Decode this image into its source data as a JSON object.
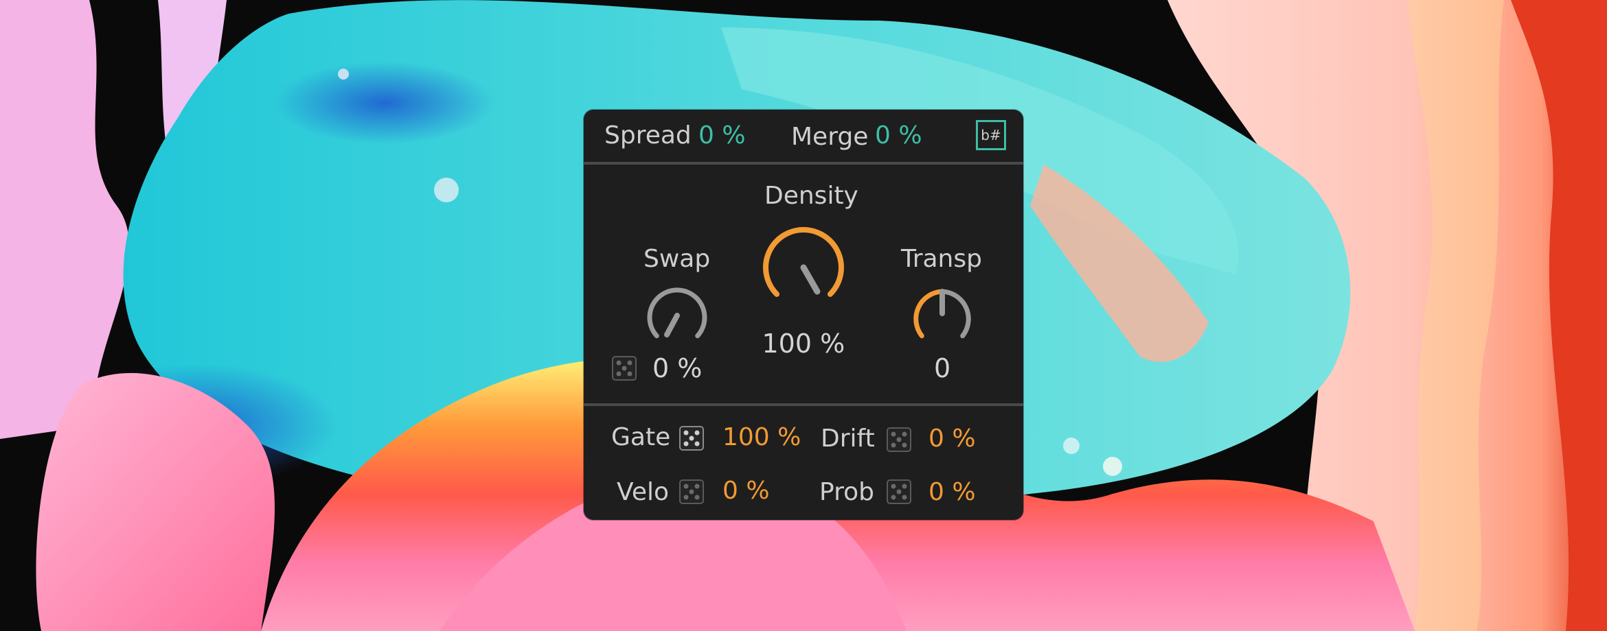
{
  "top": {
    "spread": {
      "label": "Spread",
      "value": "0 %"
    },
    "merge": {
      "label": "Merge",
      "value": "0 %"
    },
    "mode_button": {
      "glyph": "b#",
      "icon": "flat-sharp-icon"
    }
  },
  "knobs": {
    "swap": {
      "label": "Swap",
      "value": "0 %",
      "level": 0.0
    },
    "density": {
      "label": "Density",
      "value": "100 %",
      "level": 1.0
    },
    "transp": {
      "label": "Transp",
      "value": "0",
      "level": 0.5
    }
  },
  "bottom": {
    "gate": {
      "label": "Gate",
      "value": "100 %"
    },
    "drift": {
      "label": "Drift",
      "value": "0 %"
    },
    "velo": {
      "label": "Velo",
      "value": "0 %"
    },
    "prob": {
      "label": "Prob",
      "value": "0 %"
    }
  },
  "colors": {
    "panel": "#1e1e1e",
    "teal": "#3dbfa6",
    "orange": "#f29a33",
    "track": "#9a9a9a",
    "text": "#cfcfcf"
  }
}
